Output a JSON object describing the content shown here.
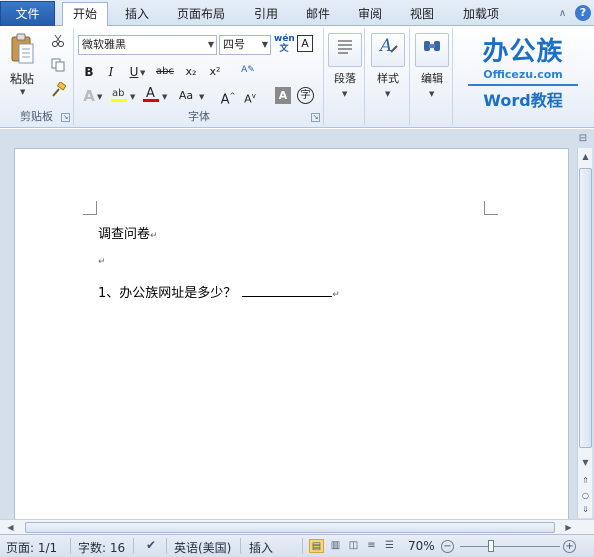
{
  "tabs": {
    "file": "文件",
    "items": [
      "开始",
      "插入",
      "页面布局",
      "引用",
      "邮件",
      "审阅",
      "视图",
      "加载项"
    ]
  },
  "ribbon": {
    "clipboard": {
      "paste": "粘贴",
      "label": "剪贴板"
    },
    "font": {
      "font_name": "微软雅黑",
      "font_size": "四号",
      "label": "字体",
      "phonetic": "wén",
      "bold": "B",
      "italic": "I",
      "underline": "U",
      "strike": "abc",
      "sub": "x₂",
      "sup": "x²",
      "change_case": "Aa",
      "grow": "A",
      "shrink": "A"
    },
    "paragraph": {
      "label": "段落"
    },
    "styles": {
      "label": "样式"
    },
    "editing": {
      "label": "编辑"
    }
  },
  "logo": {
    "cn": "办公族",
    "en": "Officezu.com",
    "sub": "Word教程"
  },
  "document": {
    "line1": "调查问卷",
    "line3_prefix": "1、办公族网址是多少？",
    "para_mark": "↵"
  },
  "status": {
    "page": "页面: 1/1",
    "words": "字数: 16",
    "language": "英语(美国)",
    "mode": "插入",
    "zoom": "70%"
  },
  "colors": {
    "accent": "#1b6fc4",
    "file_tab": "#2f6cc0",
    "highlight": "#ffff00",
    "font_color": "#e00000"
  }
}
